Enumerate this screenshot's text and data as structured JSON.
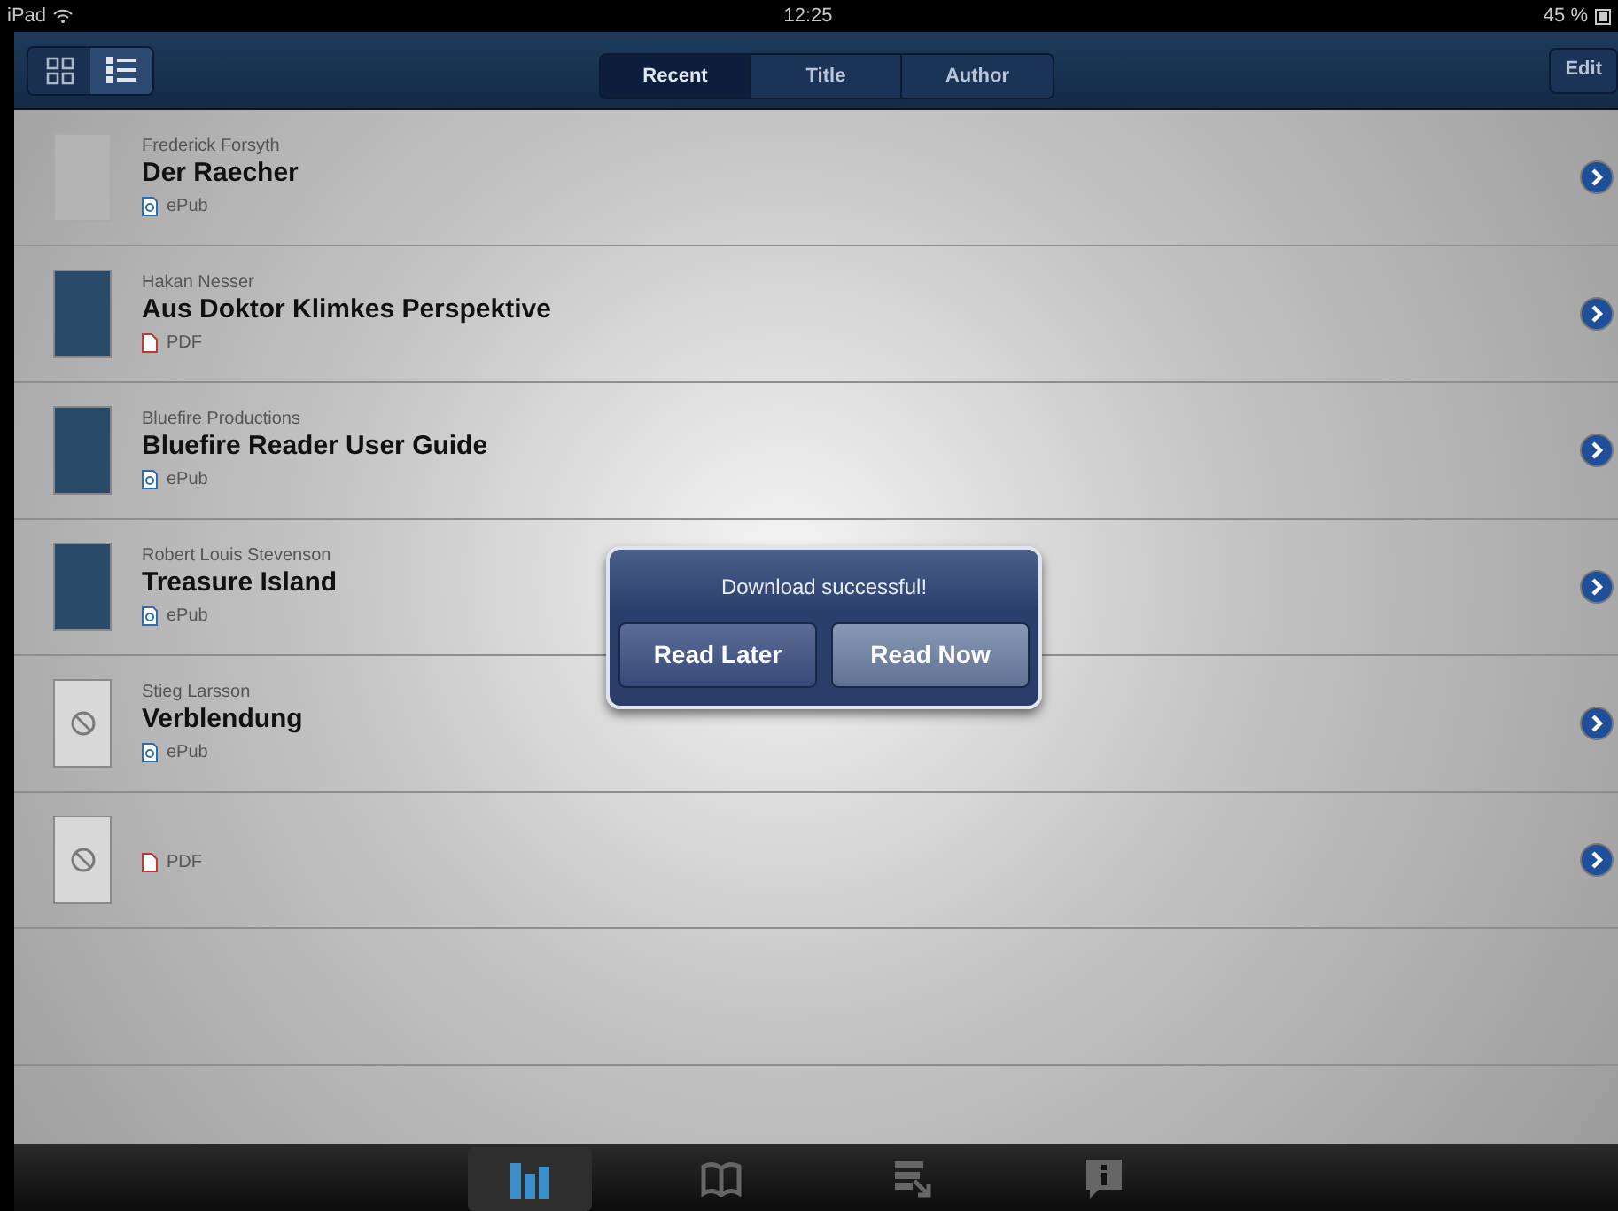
{
  "status_bar": {
    "carrier": "iPad",
    "time": "12:25",
    "battery": "45 %"
  },
  "nav_bar": {
    "view_toggle": [
      {
        "kind": "grid",
        "selected": false
      },
      {
        "kind": "list",
        "selected": true
      }
    ],
    "sort_segments": [
      {
        "label": "Recent",
        "selected": true
      },
      {
        "label": "Title",
        "selected": false
      },
      {
        "label": "Author",
        "selected": false
      }
    ],
    "edit_button": "Edit"
  },
  "books": [
    {
      "author": "Frederick Forsyth",
      "title": "Der Raecher",
      "format": {
        "kind": "epub",
        "label": "ePub"
      },
      "cover": {
        "kind": "title-page"
      }
    },
    {
      "author": "Hakan Nesser",
      "title": "Aus Doktor Klimkes Perspektive",
      "format": {
        "kind": "pdf",
        "label": "PDF"
      },
      "cover": {
        "kind": "photo"
      }
    },
    {
      "author": "Bluefire Productions",
      "title": "Bluefire Reader User Guide",
      "format": {
        "kind": "epub",
        "label": "ePub"
      },
      "cover": {
        "kind": "photo"
      }
    },
    {
      "author": "Robert Louis Stevenson",
      "title": "Treasure Island",
      "format": {
        "kind": "epub",
        "label": "ePub"
      },
      "cover": {
        "kind": "photo"
      }
    },
    {
      "author": "Stieg Larsson",
      "title": "Verblendung",
      "format": {
        "kind": "epub",
        "label": "ePub"
      },
      "cover": {
        "kind": "missing"
      }
    },
    {
      "format": {
        "kind": "pdf",
        "label": "PDF"
      },
      "cover": {
        "kind": "missing"
      }
    }
  ],
  "alert": {
    "message": "Download successful!",
    "buttons": [
      {
        "label": "Read Later",
        "selected": false
      },
      {
        "label": "Read Now",
        "selected": true
      }
    ]
  },
  "tab_bar": [
    {
      "kind": "library",
      "selected": true
    },
    {
      "kind": "book",
      "selected": false
    },
    {
      "kind": "get-books",
      "selected": false
    },
    {
      "kind": "info",
      "selected": false
    }
  ]
}
